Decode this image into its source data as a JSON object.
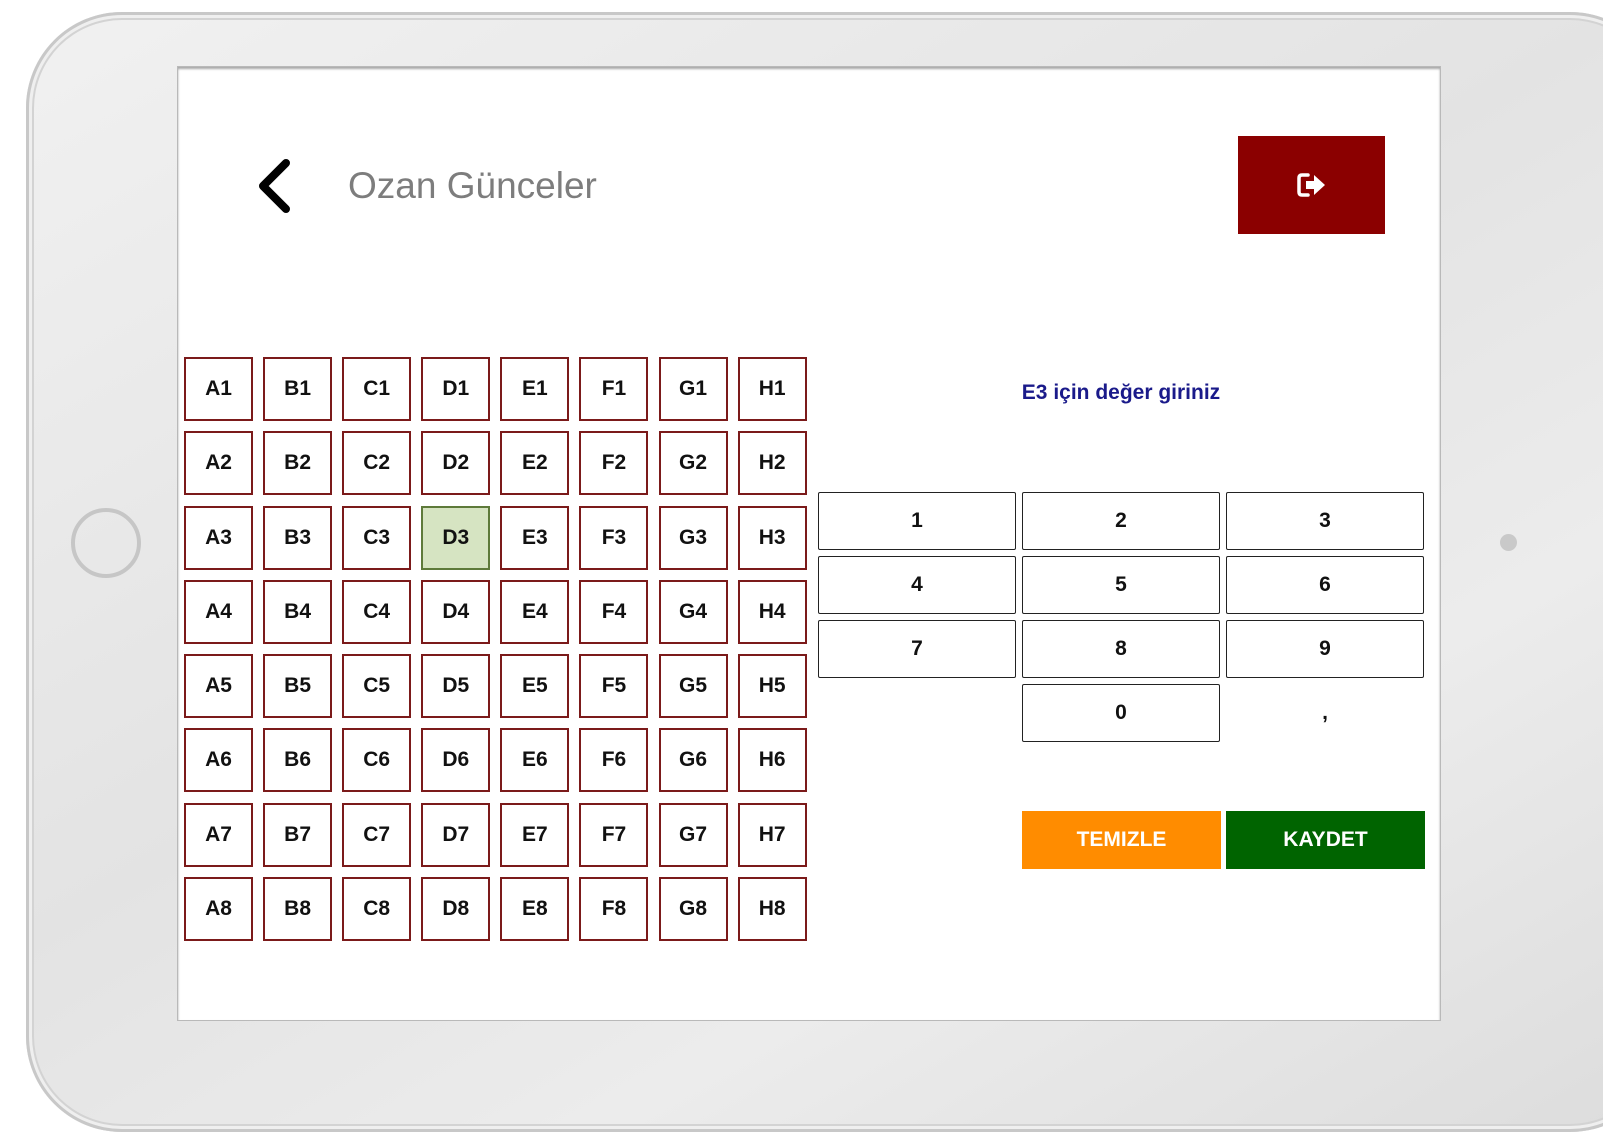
{
  "header": {
    "title": "Ozan Günceler"
  },
  "grid": {
    "selected": "D3",
    "rows": [
      [
        "A1",
        "B1",
        "C1",
        "D1",
        "E1",
        "F1",
        "G1",
        "H1"
      ],
      [
        "A2",
        "B2",
        "C2",
        "D2",
        "E2",
        "F2",
        "G2",
        "H2"
      ],
      [
        "A3",
        "B3",
        "C3",
        "D3",
        "E3",
        "F3",
        "G3",
        "H3"
      ],
      [
        "A4",
        "B4",
        "C4",
        "D4",
        "E4",
        "F4",
        "G4",
        "H4"
      ],
      [
        "A5",
        "B5",
        "C5",
        "D5",
        "E5",
        "F5",
        "G5",
        "H5"
      ],
      [
        "A6",
        "B6",
        "C6",
        "D6",
        "E6",
        "F6",
        "G6",
        "H6"
      ],
      [
        "A7",
        "B7",
        "C7",
        "D7",
        "E7",
        "F7",
        "G7",
        "H7"
      ],
      [
        "A8",
        "B8",
        "C8",
        "D8",
        "E8",
        "F8",
        "G8",
        "H8"
      ]
    ]
  },
  "entry": {
    "prompt": "E3 için değer giriniz"
  },
  "keypad": {
    "keys": [
      "1",
      "2",
      "3",
      "4",
      "5",
      "6",
      "7",
      "8",
      "9",
      "",
      "0",
      ","
    ]
  },
  "actions": {
    "clear_label": "TEMIZLE",
    "save_label": "KAYDET"
  },
  "colors": {
    "logout_bg": "#8b0000",
    "clear_bg": "#ff8c00",
    "save_bg": "#006400",
    "well_border": "#7b1a1a",
    "selected_well_bg": "#d6e4c2",
    "prompt_text": "#1a1a8a"
  },
  "icons": {
    "back": "chevron-left-icon",
    "logout": "sign-out-icon"
  }
}
